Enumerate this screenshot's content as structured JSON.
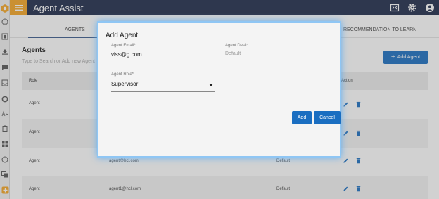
{
  "header": {
    "title": "Agent Assist",
    "menu_icon": "hamburger-icon",
    "actions": [
      "fullscreen-icon",
      "gear-icon",
      "account-icon"
    ],
    "colors": {
      "bar": "#1e2a4a",
      "menu": "#f5a623"
    }
  },
  "tabs": {
    "items": [
      "AGENTS",
      "RECOMMENDATION TO LEARN"
    ],
    "active": "AGENTS"
  },
  "section": {
    "title": "Agents",
    "search_placeholder": "Type to Search or Add new Agent",
    "add_button_label": "Add Agent"
  },
  "table": {
    "columns": [
      "Role",
      "",
      "",
      "Action"
    ],
    "rows": [
      {
        "role": "Agent",
        "email": "",
        "desk": ""
      },
      {
        "role": "Agent",
        "email": "",
        "desk": ""
      },
      {
        "role": "Agent",
        "email": "agent@hcl.com",
        "desk": "Default"
      },
      {
        "role": "Agent",
        "email": "agent1@hcl.com",
        "desk": "Default"
      }
    ]
  },
  "modal": {
    "title": "Add Agent",
    "email_label": "Agent Email*",
    "email_value": "viss@g.com",
    "desk_label": "Agent Desk*",
    "desk_value": "Default",
    "role_label": "Agent Role*",
    "role_value": "Supervisor",
    "add_label": "Add",
    "cancel_label": "Cancel"
  },
  "accent_color": "#1a6ec1"
}
